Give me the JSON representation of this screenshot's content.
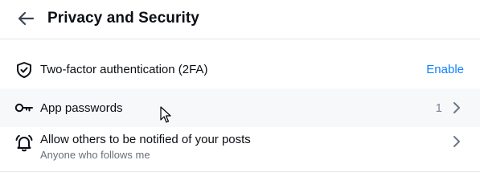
{
  "header": {
    "title": "Privacy and Security",
    "back_icon": "arrow-left-icon"
  },
  "settings": [
    {
      "label": "Two-factor authentication (2FA)",
      "icon": "shield-check-icon",
      "action": "Enable"
    },
    {
      "label": "App passwords",
      "icon": "key-icon",
      "count": "1",
      "chevron": "chevron-right-icon"
    },
    {
      "label": "Allow others to be notified of your posts",
      "sublabel": "Anyone who follows me",
      "icon": "bell-ringing-icon",
      "chevron": "chevron-right-icon"
    }
  ],
  "colors": {
    "accent": "#1083fe",
    "text": "#0b0f14",
    "muted": "#66707c",
    "row_hover": "#f6f8fa",
    "divider": "#e3e6ea"
  }
}
